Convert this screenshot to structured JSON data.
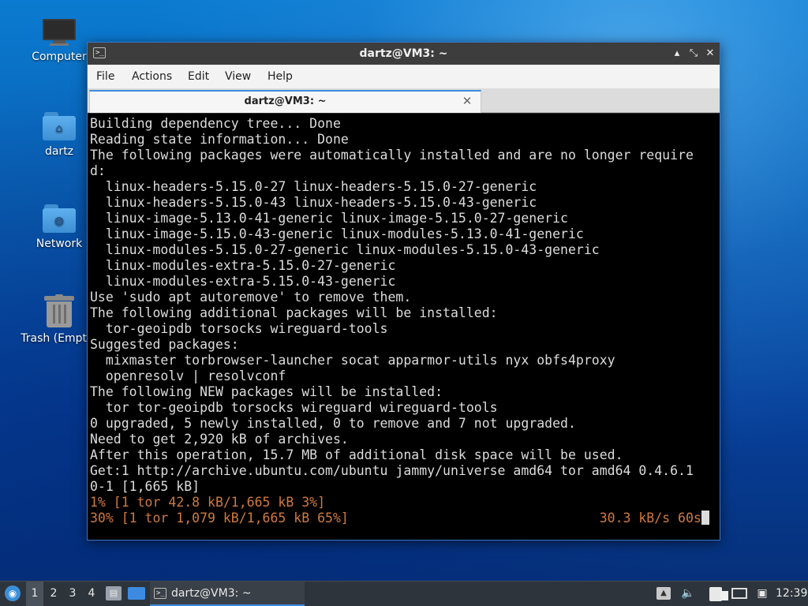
{
  "desktop": {
    "icons": [
      {
        "label": "Computer",
        "icon": "computer-icon"
      },
      {
        "label": "dartz",
        "icon": "home-folder-icon"
      },
      {
        "label": "Network",
        "icon": "network-folder-icon"
      },
      {
        "label": "Trash (Empty)",
        "icon": "trash-icon"
      }
    ]
  },
  "window": {
    "title": "dartz@VM3: ~",
    "controls": {
      "minimize": "▴",
      "maximize": "⤡",
      "close": "✕"
    },
    "menu": [
      "File",
      "Actions",
      "Edit",
      "View",
      "Help"
    ],
    "tab": {
      "label": "dartz@VM3: ~",
      "close": "✕"
    }
  },
  "terminal": {
    "lines": [
      "Building dependency tree... Done",
      "Reading state information... Done",
      "The following packages were automatically installed and are no longer require",
      "d:",
      "  linux-headers-5.15.0-27 linux-headers-5.15.0-27-generic",
      "  linux-headers-5.15.0-43 linux-headers-5.15.0-43-generic",
      "  linux-image-5.13.0-41-generic linux-image-5.15.0-27-generic",
      "  linux-image-5.15.0-43-generic linux-modules-5.13.0-41-generic",
      "  linux-modules-5.15.0-27-generic linux-modules-5.15.0-43-generic",
      "  linux-modules-extra-5.15.0-27-generic",
      "  linux-modules-extra-5.15.0-43-generic",
      "Use 'sudo apt autoremove' to remove them.",
      "The following additional packages will be installed:",
      "  tor-geoipdb torsocks wireguard-tools",
      "Suggested packages:",
      "  mixmaster torbrowser-launcher socat apparmor-utils nyx obfs4proxy",
      "  openresolv | resolvconf",
      "The following NEW packages will be installed:",
      "  tor tor-geoipdb torsocks wireguard wireguard-tools",
      "0 upgraded, 5 newly installed, 0 to remove and 7 not upgraded.",
      "Need to get 2,920 kB of archives.",
      "After this operation, 15.7 MB of additional disk space will be used.",
      "Get:1 http://archive.ubuntu.com/ubuntu jammy/universe amd64 tor amd64 0.4.6.1",
      "0-1 [1,665 kB]",
      "1% [1 tor 42.8 kB/1,665 kB 3%]",
      "30% [1 tor 1,079 kB/1,665 kB 65%]                                30.3 kB/s 60s"
    ],
    "progress_color": "#d07a3f",
    "text_color": "#dcdcdc"
  },
  "taskbar": {
    "start_icon": "start-menu-icon",
    "workspaces": [
      "1",
      "2",
      "3",
      "4"
    ],
    "active_workspace": "1",
    "task": {
      "label": "dartz@VM3: ~"
    },
    "clock": "12:39"
  }
}
